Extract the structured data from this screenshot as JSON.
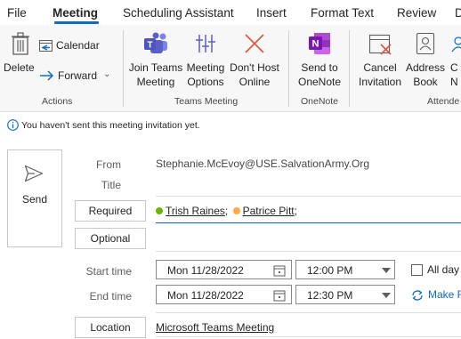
{
  "tabs": [
    "File",
    "Meeting",
    "Scheduling Assistant",
    "Insert",
    "Format Text",
    "Review",
    "D"
  ],
  "ribbon": {
    "delete": "Delete",
    "calendar": "Calendar",
    "forward": "Forward",
    "actions_group": "Actions",
    "join_teams_1": "Join Teams",
    "join_teams_2": "Meeting",
    "meeting_options_1": "Meeting",
    "meeting_options_2": "Options",
    "dont_host_1": "Don't Host",
    "dont_host_2": "Online",
    "teams_group": "Teams Meeting",
    "send_onenote_1": "Send to",
    "send_onenote_2": "OneNote",
    "onenote_group": "OneNote",
    "cancel_1": "Cancel",
    "cancel_2": "Invitation",
    "address_1": "Address",
    "address_2": "Book",
    "check_1": "C",
    "check_2": "N",
    "attendees_group": "Attende"
  },
  "info": "You haven't sent this meeting invitation yet.",
  "form": {
    "send": "Send",
    "from_label": "From",
    "from_value": "Stephanie.McEvoy@USE.SalvationArmy.Org",
    "title_label": "Title",
    "required_label": "Required",
    "attendee1": "Trish Raines",
    "sep1": ";",
    "attendee2": "Patrice Pitt",
    "sep2": ";",
    "optional_label": "Optional",
    "start_label": "Start time",
    "start_date": "Mon 11/28/2022",
    "start_time": "12:00 PM",
    "allday": "All day",
    "end_label": "End time",
    "end_date": "Mon 11/28/2022",
    "end_time": "12:30 PM",
    "make_recurring": "Make R",
    "location_label": "Location",
    "location_value": "Microsoft Teams Meeting"
  },
  "colors": {
    "accent": "#0f6cbd",
    "teams_purple": "#5b5fc7",
    "onenote_purple": "#7719aa",
    "dont_host_red": "#e0533d",
    "presence_green": "#6bb700",
    "presence_yellow": "#ffaa44"
  }
}
